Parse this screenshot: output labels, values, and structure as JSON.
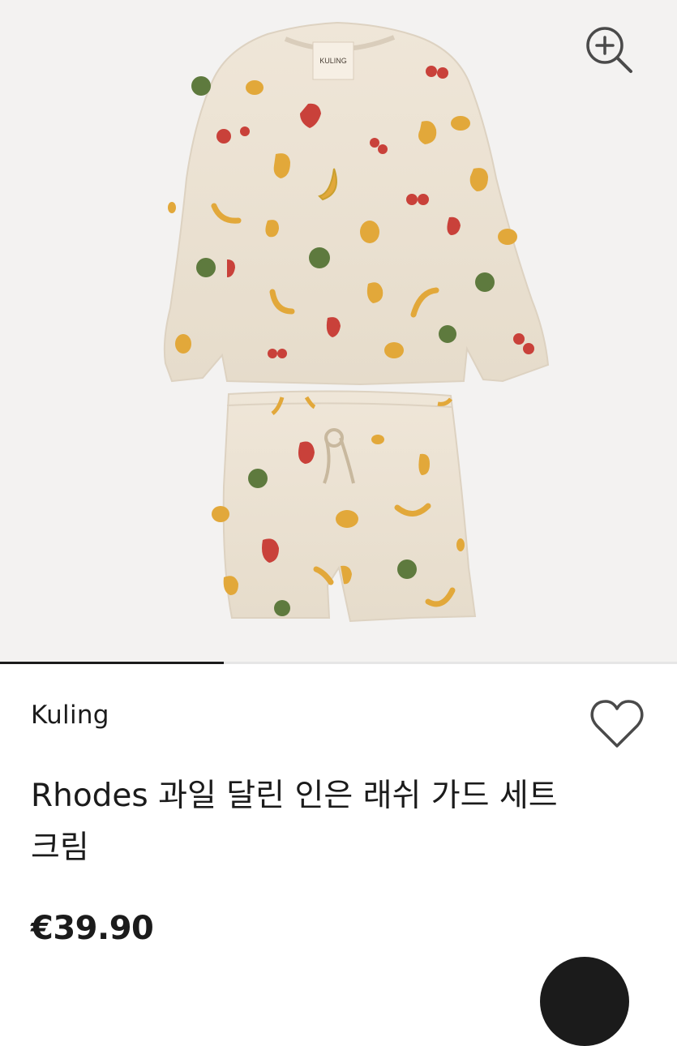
{
  "product": {
    "label_tag": "KULING",
    "brand": "Kuling",
    "title": "Rhodes 과일 달린 인은 래쉬 가드 세트 크림",
    "price": "€39.90",
    "gallery_progress": 0.33
  },
  "icons": {
    "zoom": "zoom-in-icon",
    "wishlist": "heart-outline-icon"
  },
  "colors": {
    "gallery_bg": "#f3f2f1",
    "fabric": "#ede3d4",
    "text": "#1b1b1b"
  }
}
